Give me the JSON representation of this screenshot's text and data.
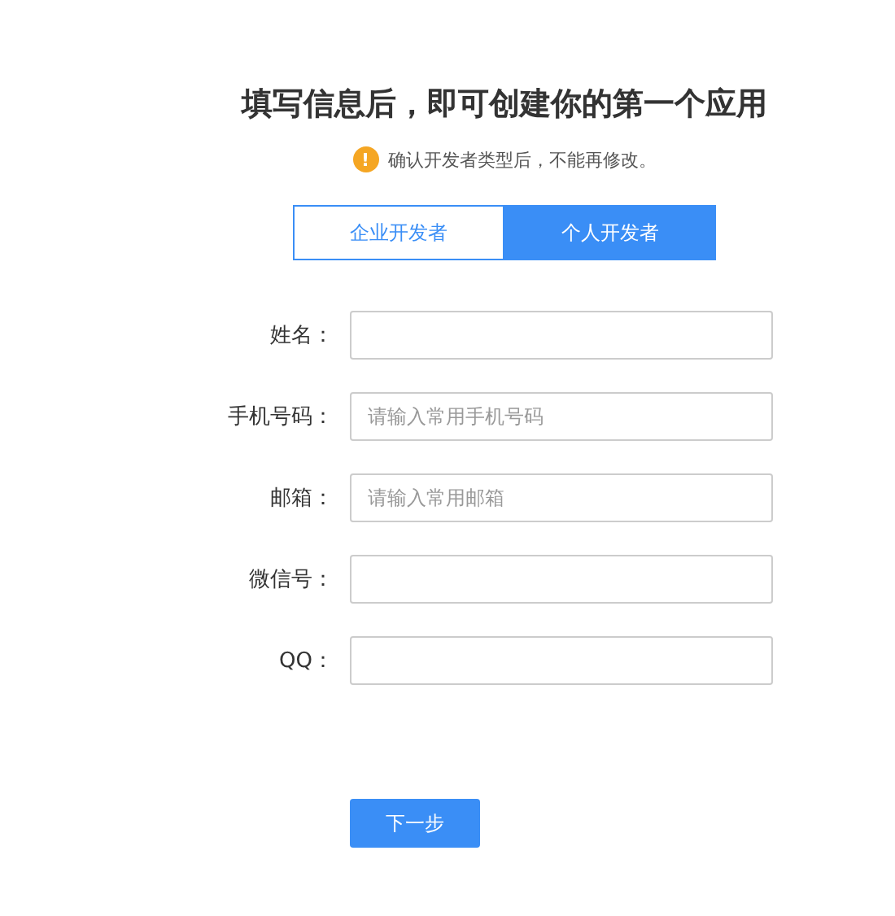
{
  "title": "填写信息后，即可创建你的第一个应用",
  "notice": {
    "icon": "!",
    "text": "确认开发者类型后，不能再修改。"
  },
  "tabs": [
    {
      "label": "企业开发者",
      "selected": false
    },
    {
      "label": "个人开发者",
      "selected": true
    }
  ],
  "fields": [
    {
      "label": "姓名："
    },
    {
      "label": "手机号码：",
      "placeholder": "请输入常用手机号码"
    },
    {
      "label": "邮箱：",
      "placeholder": "请输入常用邮箱"
    },
    {
      "label": "微信号："
    },
    {
      "label": "QQ："
    }
  ],
  "next_button": "下一步"
}
